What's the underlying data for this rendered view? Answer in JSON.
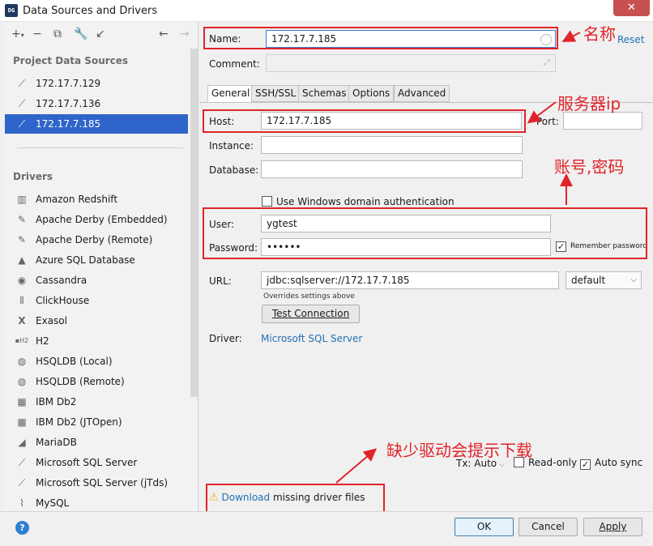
{
  "window": {
    "title": "Data Sources and Drivers",
    "app_icon": "DG"
  },
  "sidebar": {
    "project_header": "Project Data Sources",
    "data_sources": [
      {
        "label": "172.17.7.129",
        "icon": "mssql-icon"
      },
      {
        "label": "172.17.7.136",
        "icon": "mssql-icon"
      },
      {
        "label": "172.17.7.185",
        "icon": "mssql-icon",
        "selected": true
      }
    ],
    "drivers_header": "Drivers",
    "drivers": [
      {
        "label": "Amazon Redshift",
        "icon": "redshift-icon"
      },
      {
        "label": "Apache Derby (Embedded)",
        "icon": "derby-icon"
      },
      {
        "label": "Apache Derby (Remote)",
        "icon": "derby-icon"
      },
      {
        "label": "Azure SQL Database",
        "icon": "azure-icon"
      },
      {
        "label": "Cassandra",
        "icon": "cassandra-icon"
      },
      {
        "label": "ClickHouse",
        "icon": "clickhouse-icon"
      },
      {
        "label": "Exasol",
        "icon": "exasol-icon"
      },
      {
        "label": "H2",
        "icon": "h2-icon"
      },
      {
        "label": "HSQLDB (Local)",
        "icon": "hsqldb-icon"
      },
      {
        "label": "HSQLDB (Remote)",
        "icon": "hsqldb-icon"
      },
      {
        "label": "IBM Db2",
        "icon": "db2-icon"
      },
      {
        "label": "IBM Db2 (JTOpen)",
        "icon": "db2-icon"
      },
      {
        "label": "MariaDB",
        "icon": "mariadb-icon"
      },
      {
        "label": "Microsoft SQL Server",
        "icon": "mssql-icon"
      },
      {
        "label": "Microsoft SQL Server (jTds)",
        "icon": "mssql-icon"
      },
      {
        "label": "MySQL",
        "icon": "mysql-icon"
      }
    ]
  },
  "form": {
    "name_label": "Name:",
    "name_value": "172.17.7.185",
    "reset_label": "Reset",
    "comment_label": "Comment:",
    "tabs": [
      "General",
      "SSH/SSL",
      "Schemas",
      "Options",
      "Advanced"
    ],
    "active_tab": "General",
    "host_label": "Host:",
    "host_value": "172.17.7.185",
    "port_label": "Port:",
    "port_value": "",
    "instance_label": "Instance:",
    "database_label": "Database:",
    "windows_auth_label": "Use Windows domain authentication",
    "user_label": "User:",
    "user_value": "ygtest",
    "password_label": "Password:",
    "password_value": "••••••",
    "remember_password_label": "Remember password",
    "url_label": "URL:",
    "url_value": "jdbc:sqlserver://172.17.7.185",
    "url_mode": "default",
    "url_hint": "Overrides settings above",
    "test_connection_label": "Test Connection",
    "driver_label": "Driver:",
    "driver_value": "Microsoft SQL Server",
    "tx_label": "Tx: Auto",
    "readonly_label": "Read-only",
    "autosync_label": "Auto sync",
    "download_link": "Download",
    "download_text": " missing driver files"
  },
  "buttons": {
    "ok": "OK",
    "cancel": "Cancel",
    "apply": "Apply",
    "help": "?"
  },
  "annotations": {
    "name": "名称",
    "server_ip": "服务器ip",
    "account": "账号,密码",
    "driver": "缺少驱动会提示下载"
  },
  "colors": {
    "selection": "#2f65ca",
    "link": "#2470b3",
    "annotation": "#e0242a",
    "warning": "#f0b400"
  }
}
